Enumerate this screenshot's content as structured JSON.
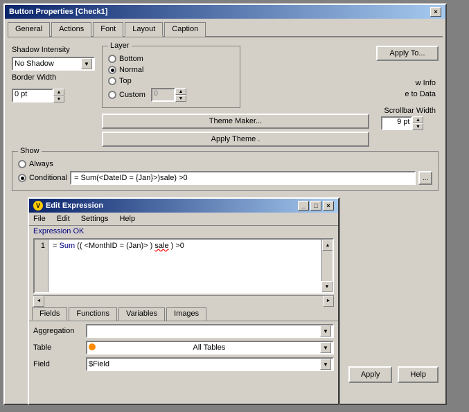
{
  "mainWindow": {
    "title": "Button Properties [Check1]",
    "closeBtn": "×"
  },
  "tabs": {
    "items": [
      "General",
      "Actions",
      "Font",
      "Layout",
      "Caption"
    ],
    "active": "Layout"
  },
  "layout": {
    "shadowIntensity": {
      "label": "Shadow Intensity",
      "value": "No Shadow"
    },
    "borderWidth": {
      "label": "Border Width",
      "value": "0 pt"
    },
    "layer": {
      "groupLabel": "Layer",
      "options": [
        "Bottom",
        "Normal",
        "Top",
        "Custom"
      ],
      "selected": "Normal",
      "customValue": "0"
    },
    "applyToBtn": "Apply To...",
    "themeMakerBtn": "Theme Maker...",
    "applyThemeBtn": "Apply Theme .",
    "show": {
      "groupLabel": "Show",
      "options": [
        "Always",
        "Conditional"
      ],
      "selected": "Conditional",
      "expression": "= Sum(<DateID = {Jan}>)sale) >0"
    },
    "rightPanel": {
      "infoText": "w Info",
      "toDataText": "e to Data",
      "scrollbarWidthLabel": "Scrollbar Width",
      "scrollbarWidthValue": "9 pt"
    }
  },
  "actionBtns": {
    "apply": "Apply",
    "help": "Help"
  },
  "editExpression": {
    "title": "Edit Expression",
    "menuItems": [
      "File",
      "Edit",
      "Settings",
      "Help"
    ],
    "status": "Expression OK",
    "lineNumber": "1",
    "code": "= Sum((<MonthID = (Jan)>) sale) >0",
    "tabs": [
      "Fields",
      "Functions",
      "Variables",
      "Images"
    ],
    "activeTab": "Fields",
    "aggregationLabel": "Aggregation",
    "aggregationValue": "",
    "tableLabel": "Table",
    "tableValue": "All Tables",
    "fieldLabel": "Field",
    "fieldValue": "$Field"
  }
}
